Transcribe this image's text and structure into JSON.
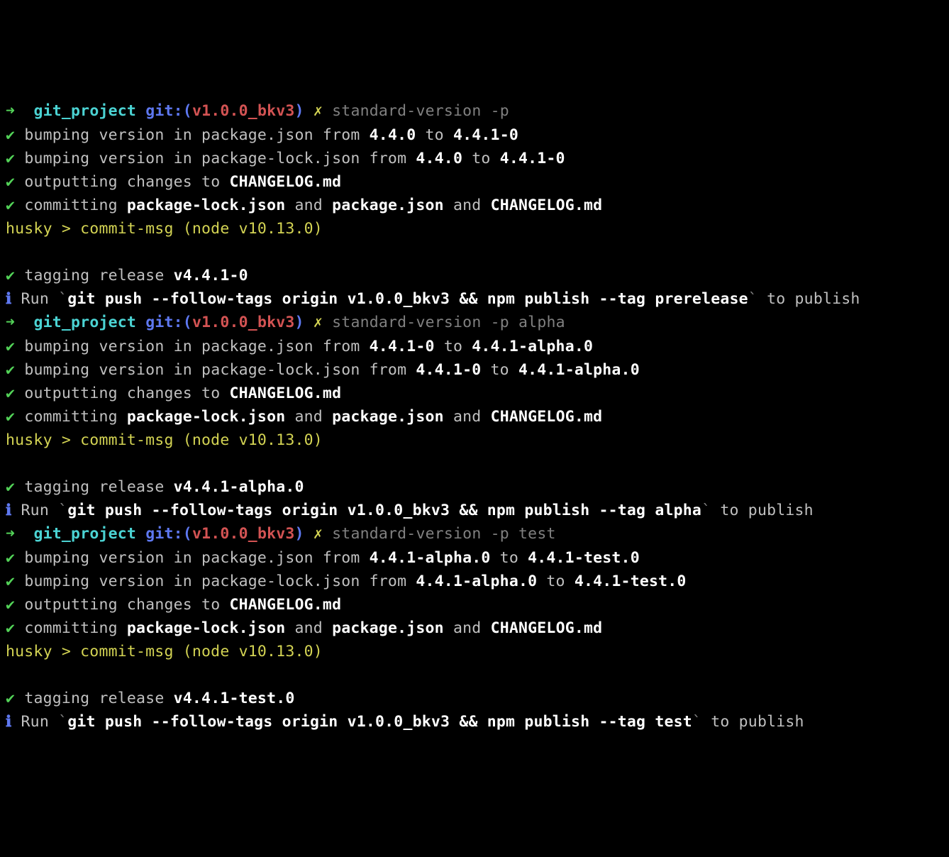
{
  "prompt": {
    "arrow": "➜",
    "dir": "git_project",
    "git_label": "git:(",
    "branch": "v1.0.0_bkv3",
    "close_paren": ")",
    "dirty": "✗"
  },
  "glyph": {
    "check": "✔",
    "info": "ℹ"
  },
  "txt": {
    "bump_pkg_pre": "bumping version in package.json from ",
    "bump_lock_pre": "bumping version in package-lock.json from ",
    "to": " to ",
    "out_pre": "outputting changes to ",
    "changelog": "CHANGELOG.md",
    "commit_pre": "committing ",
    "pkg_lock": "package-lock.json",
    "and": " and ",
    "pkg_json": "package.json",
    "husky": "husky > commit-msg (node v10.13.0)",
    "tag_pre": "tagging release ",
    "run": "Run ",
    "tick": "`",
    "to_publish": " to publish"
  },
  "blocks": [
    {
      "cmd": "standard-version -p",
      "from": "4.4.0",
      "to": "4.4.1-0",
      "tag": "v4.4.1-0",
      "push": "git push --follow-tags origin v1.0.0_bkv3 && npm publish --tag prerelease"
    },
    {
      "cmd": "standard-version -p alpha",
      "from": "4.4.1-0",
      "to": "4.4.1-alpha.0",
      "tag": "v4.4.1-alpha.0",
      "push": "git push --follow-tags origin v1.0.0_bkv3 && npm publish --tag alpha"
    },
    {
      "cmd": "standard-version -p test",
      "from": "4.4.1-alpha.0",
      "to": "4.4.1-test.0",
      "tag": "v4.4.1-test.0",
      "push": "git push --follow-tags origin v1.0.0_bkv3 && npm publish --tag test"
    }
  ]
}
